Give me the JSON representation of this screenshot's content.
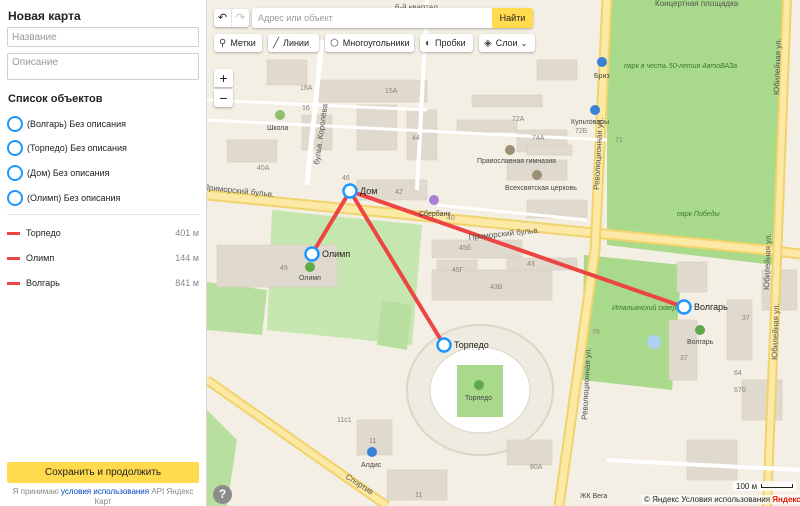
{
  "panel": {
    "title": "Новая карта",
    "name_placeholder": "Название",
    "desc_placeholder": "Описание",
    "list_title": "Список объектов",
    "objects": [
      {
        "label": "(Волгарь) Без описания"
      },
      {
        "label": "(Торпедо) Без описания"
      },
      {
        "label": "(Дом) Без описания"
      },
      {
        "label": "(Олимп) Без описания"
      }
    ],
    "lines": [
      {
        "label": "Торпедо",
        "length": "401 м"
      },
      {
        "label": "Олимп",
        "length": "144 м"
      },
      {
        "label": "Волгарь",
        "length": "841 м"
      }
    ],
    "save_label": "Сохранить и продолжить",
    "terms_prefix": "Я принимаю",
    "terms_link": "условия использования",
    "terms_suffix": "API Яндекс Карт"
  },
  "toolbar": {
    "undo_icon": "undo-icon",
    "redo_icon": "redo-icon",
    "search_placeholder": "Адрес или объект",
    "search_button": "Найти",
    "tools": [
      {
        "label": "Метки",
        "icon": "placemark-icon"
      },
      {
        "label": "Линии",
        "icon": "line-icon"
      },
      {
        "label": "Многоугольники",
        "icon": "polygon-icon"
      },
      {
        "label": "Пробки",
        "icon": "traffic-icon"
      },
      {
        "label": "Слои",
        "icon": "layers-icon"
      }
    ],
    "zoom_in": "+",
    "zoom_out": "−",
    "help": "?"
  },
  "map": {
    "accent": "#1e98ff",
    "route_color": "#ed4543",
    "markers": [
      {
        "label": "Дом"
      },
      {
        "label": "Олимп"
      },
      {
        "label": "Торпедо"
      },
      {
        "label": "Волгарь"
      }
    ],
    "streets": {
      "primorsky_top": "Приморский бульв.",
      "primorsky_mid": "Приморский бульв.",
      "revolution_a": "Революционная ул.",
      "revolution_b": "Революционная ул.",
      "jubilee_a": "Юбилейная ул.",
      "jubilee_b": "Юбилейная ул.",
      "jubilee_c": "Юбилейная ул.",
      "korolev": "бульв. Королёва",
      "sport": "Спортив",
      "kvartal": "6-й квартал",
      "concert": "Концертная площадка"
    },
    "pois": {
      "school": "Школа",
      "sberbank": "Сбербанк",
      "gymnasium": "Православная гимназия",
      "church": "Всехсвятская церковь",
      "briz": "Бриз",
      "kultovary": "Культовары",
      "olimp_poi": "Олимп",
      "torpedo_poi": "Торпедо",
      "volgar_poi": "Волгарь",
      "aldis": "Алдис",
      "park_autovaz": "парк в честь 50-летия АвтоВАЗа",
      "park_pobedy": "парк Победы",
      "italian_square": "Итальянский сквер",
      "vega": "ЖК Вега"
    },
    "houses": [
      "15А",
      "18А",
      "16",
      "46",
      "42",
      "40",
      "45б",
      "45Г",
      "43",
      "43В",
      "49",
      "40А",
      "44",
      "72А",
      "74А",
      "72Б",
      "79",
      "37",
      "37",
      "64",
      "67б",
      "11",
      "11с1",
      "11",
      "80А",
      "71"
    ],
    "scale_label": "100 м",
    "copyright": "© Яндекс Условия использования",
    "logo": "Яндекс"
  }
}
